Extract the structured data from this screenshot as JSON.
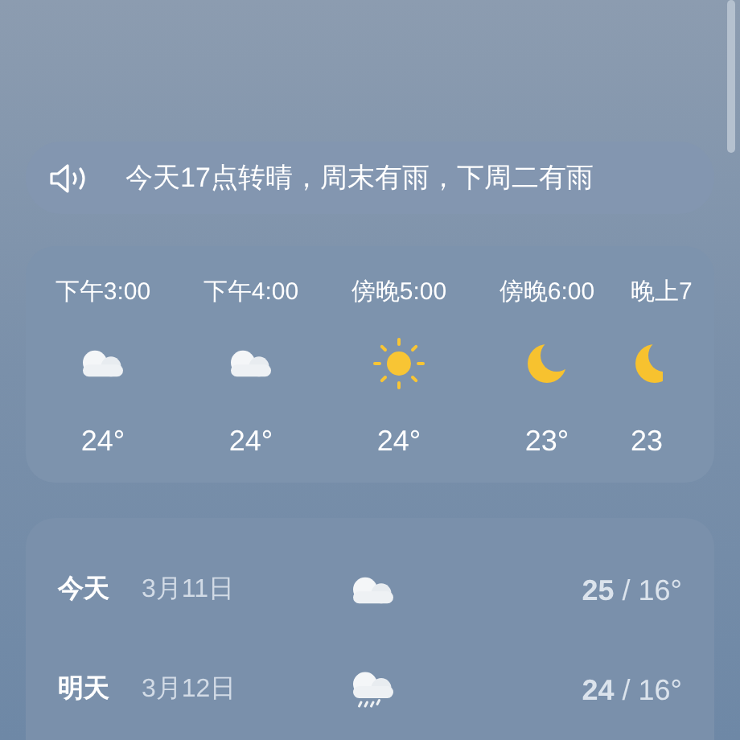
{
  "banner": {
    "text": "今天17点转晴，周末有雨，下周二有雨"
  },
  "hourly": [
    {
      "time": "下午3:00",
      "kind": "cloudy",
      "temp": "24°"
    },
    {
      "time": "下午4:00",
      "kind": "cloudy",
      "temp": "24°"
    },
    {
      "time": "傍晚5:00",
      "kind": "sunny",
      "temp": "24°"
    },
    {
      "time": "傍晚6:00",
      "kind": "moon",
      "temp": "23°"
    },
    {
      "time": "晚上7",
      "kind": "moon",
      "temp": "23"
    }
  ],
  "daily": [
    {
      "day": "今天",
      "date": "3月11日",
      "kind": "cloudy",
      "temps": "**25** / 16°"
    },
    {
      "day": "明天",
      "date": "3月12日",
      "kind": "rain",
      "temps": "**24** / 16°"
    }
  ]
}
